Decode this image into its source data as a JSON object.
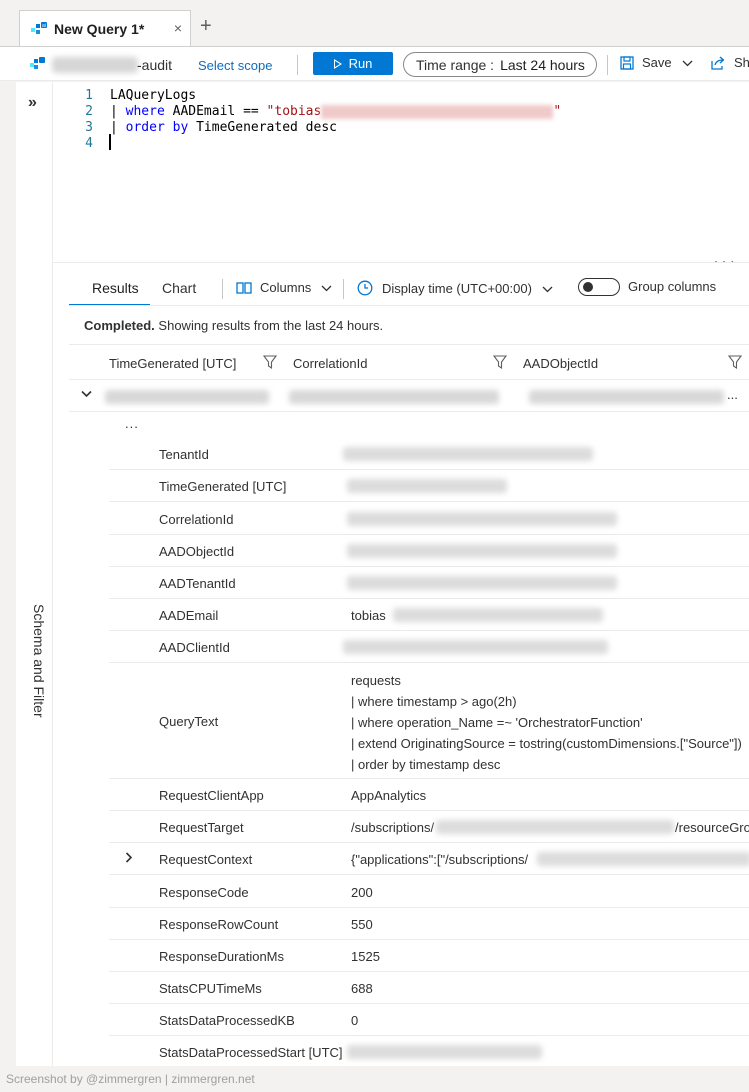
{
  "tab": {
    "title": "New Query 1*",
    "close_glyph": "×",
    "add_glyph": "+"
  },
  "toolbar": {
    "workspace_suffix": "-audit",
    "select_scope": "Select scope",
    "run": "Run",
    "time_range_label": "Time range :",
    "time_range_value": "Last 24 hours",
    "save": "Save",
    "share": "Sh"
  },
  "rail": {
    "expand_glyph": "»",
    "label": "Schema and Filter"
  },
  "editor": {
    "lines": [
      {
        "num": "1",
        "text": "LAQueryLogs"
      },
      {
        "num": "2",
        "pipe": "|",
        "keyword": "where",
        "text": "AADEmail ==",
        "string": "\"tobias",
        "string_end": "\""
      },
      {
        "num": "3",
        "pipe": "|",
        "keyword": "order by",
        "text": "TimeGenerated desc"
      },
      {
        "num": "4"
      }
    ],
    "more": "..."
  },
  "results": {
    "tabs": [
      "Results",
      "Chart"
    ],
    "columns_btn": "Columns",
    "display_time": "Display time (UTC+00:00)",
    "group_columns": "Group columns",
    "status_bold": "Completed.",
    "status_text": "Showing results from the last 24 hours.",
    "headers": [
      "TimeGenerated [UTC]",
      "CorrelationId",
      "AADObjectId"
    ],
    "row_more": "...",
    "ellipsis": "...",
    "details": [
      {
        "key": "TenantId"
      },
      {
        "key": "TimeGenerated [UTC]"
      },
      {
        "key": "CorrelationId"
      },
      {
        "key": "AADObjectId"
      },
      {
        "key": "AADTenantId"
      },
      {
        "key": "AADEmail",
        "value": "tobias"
      },
      {
        "key": "AADClientId"
      },
      {
        "key": "QueryText",
        "lines": [
          "requests",
          "| where timestamp > ago(2h)",
          "| where  operation_Name =~ 'OrchestratorFunction'",
          "| extend OriginatingSource = tostring(customDimensions.[\"Source\"])",
          "| order by timestamp desc"
        ]
      },
      {
        "key": "RequestClientApp",
        "value": "AppAnalytics"
      },
      {
        "key": "RequestTarget",
        "value": "/subscriptions/",
        "value_end": "/resourceGro"
      },
      {
        "key": "RequestContext",
        "value": "{\"applications\":[\"/subscriptions/"
      },
      {
        "key": "ResponseCode",
        "value": "200"
      },
      {
        "key": "ResponseRowCount",
        "value": "550"
      },
      {
        "key": "ResponseDurationMs",
        "value": "1525"
      },
      {
        "key": "StatsCPUTimeMs",
        "value": "688"
      },
      {
        "key": "StatsDataProcessedKB",
        "value": "0"
      },
      {
        "key": "StatsDataProcessedStart [UTC]"
      }
    ]
  },
  "footer": "Screenshot by @zimmergren | zimmergren.net",
  "colors": {
    "accent": "#0078d4",
    "keyword": "#0000ff",
    "string": "#a31515",
    "line_number": "#237893"
  }
}
